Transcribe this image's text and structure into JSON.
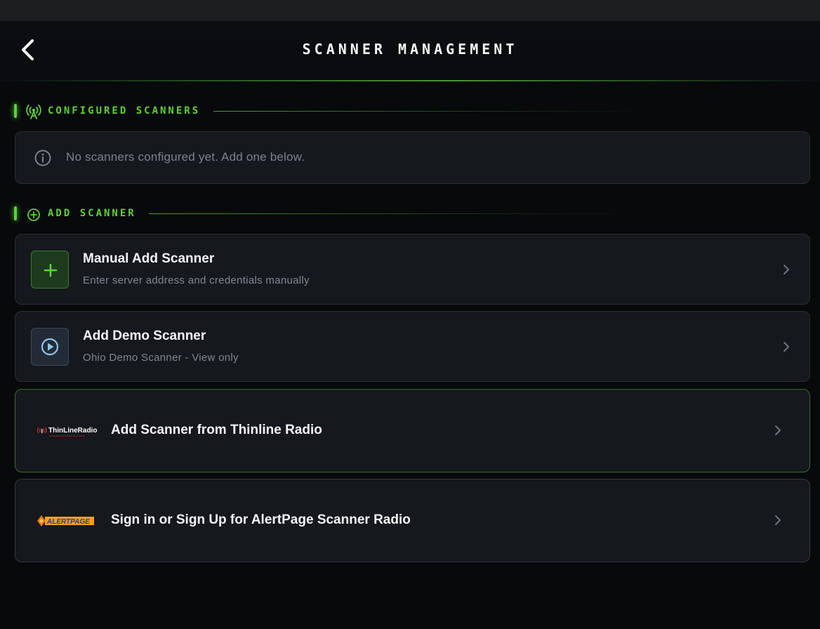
{
  "header": {
    "title": "SCANNER MANAGEMENT",
    "back_icon": "chevron-left-icon"
  },
  "sections": {
    "configured": {
      "label": "CONFIGURED SCANNERS",
      "icon": "antenna-icon",
      "empty_message": "No scanners configured yet. Add one below.",
      "empty_icon": "info-icon"
    },
    "add": {
      "label": "ADD SCANNER",
      "icon": "plus-circle-icon"
    }
  },
  "options": {
    "manual": {
      "title": "Manual Add Scanner",
      "subtitle": "Enter server address and credentials manually",
      "icon": "plus-icon"
    },
    "demo": {
      "title": "Add Demo Scanner",
      "subtitle": "Ohio Demo Scanner - View only",
      "icon": "play-circle-icon"
    },
    "thinline": {
      "title": "Add Scanner from Thinline Radio",
      "logo_text": "ThinLineRadio",
      "logo_tagline": "SCANNER SOFTWARE SOLUTIONS"
    },
    "alertpage": {
      "title": "Sign in or Sign Up for AlertPage Scanner Radio",
      "logo_text": "ALERTPAGE"
    }
  },
  "colors": {
    "accent": "#5fd13a",
    "background": "#07090b",
    "card": "#15181d"
  }
}
